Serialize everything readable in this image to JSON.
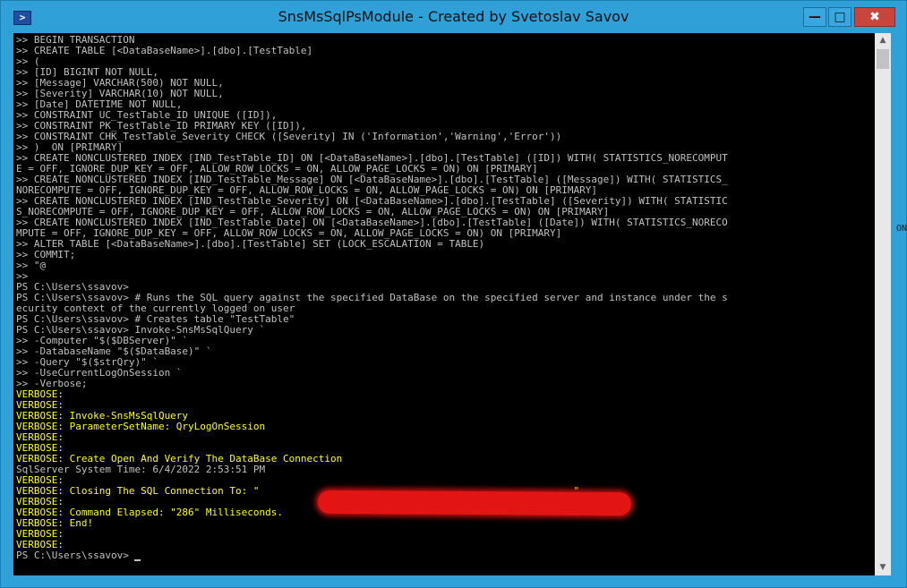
{
  "window": {
    "title": "SnsMsSqlPsModule - Created by Svetoslav Savov",
    "app_icon_glyph": ">",
    "buttons": {
      "minimize": "—",
      "maximize": "□",
      "close": "✖"
    }
  },
  "console": {
    "colors": {
      "background": "#000000",
      "text": "#c0c0c0",
      "verbose": "#ffff00"
    },
    "lines": [
      {
        "text": ">> BEGIN TRANSACTION",
        "verbose": false
      },
      {
        "text": ">> CREATE TABLE [<DataBaseName>].[dbo].[TestTable]",
        "verbose": false
      },
      {
        "text": ">> (",
        "verbose": false
      },
      {
        "text": ">> [ID] BIGINT NOT NULL,",
        "verbose": false
      },
      {
        "text": ">> [Message] VARCHAR(500) NOT NULL,",
        "verbose": false
      },
      {
        "text": ">> [Severity] VARCHAR(10) NOT NULL,",
        "verbose": false
      },
      {
        "text": ">> [Date] DATETIME NOT NULL,",
        "verbose": false
      },
      {
        "text": ">> CONSTRAINT UC_TestTable_ID UNIQUE ([ID]),",
        "verbose": false
      },
      {
        "text": ">> CONSTRAINT PK_TestTable_ID PRIMARY KEY ([ID]),",
        "verbose": false
      },
      {
        "text": ">> CONSTRAINT CHK_TestTable_Severity CHECK ([Severity] IN ('Information','Warning','Error'))",
        "verbose": false
      },
      {
        "text": ">> )  ON [PRIMARY]",
        "verbose": false
      },
      {
        "text": ">> CREATE NONCLUSTERED INDEX [IND_TestTable_ID] ON [<DataBaseName>].[dbo].[TestTable] ([ID]) WITH( STATISTICS_NORECOMPUT",
        "verbose": false
      },
      {
        "text": "E = OFF, IGNORE_DUP_KEY = OFF, ALLOW_ROW_LOCKS = ON, ALLOW_PAGE_LOCKS = ON) ON [PRIMARY]",
        "verbose": false
      },
      {
        "text": ">> CREATE NONCLUSTERED INDEX [IND_TestTable_Message] ON [<DataBaseName>].[dbo].[TestTable] ([Message]) WITH( STATISTICS_",
        "verbose": false
      },
      {
        "text": "NORECOMPUTE = OFF, IGNORE_DUP_KEY = OFF, ALLOW_ROW_LOCKS = ON, ALLOW_PAGE_LOCKS = ON) ON [PRIMARY]",
        "verbose": false
      },
      {
        "text": ">> CREATE NONCLUSTERED INDEX [IND_TestTable_Severity] ON [<DataBaseName>].[dbo].[TestTable] ([Severity]) WITH( STATISTIC",
        "verbose": false
      },
      {
        "text": "S_NORECOMPUTE = OFF, IGNORE_DUP_KEY = OFF, ALLOW_ROW_LOCKS = ON, ALLOW_PAGE_LOCKS = ON) ON [PRIMARY]",
        "verbose": false
      },
      {
        "text": ">> CREATE NONCLUSTERED INDEX [IND_TestTable_Date] ON [<DataBaseName>].[dbo].[TestTable] ([Date]) WITH( STATISTICS_NORECO",
        "verbose": false
      },
      {
        "text": "MPUTE = OFF, IGNORE_DUP_KEY = OFF, ALLOW_ROW_LOCKS = ON, ALLOW_PAGE_LOCKS = ON) ON [PRIMARY]",
        "verbose": false
      },
      {
        "text": ">> ALTER TABLE [<DataBaseName>].[dbo].[TestTable] SET (LOCK_ESCALATION = TABLE)",
        "verbose": false
      },
      {
        "text": ">> COMMIT;",
        "verbose": false
      },
      {
        "text": ">> \"@",
        "verbose": false
      },
      {
        "text": ">>",
        "verbose": false
      },
      {
        "text": "PS C:\\Users\\ssavov>",
        "verbose": false
      },
      {
        "text": "PS C:\\Users\\ssavov> # Runs the SQL query against the specified DataBase on the specified server and instance under the s",
        "verbose": false
      },
      {
        "text": "ecurity context of the currently logged on user",
        "verbose": false
      },
      {
        "text": "PS C:\\Users\\ssavov> # Creates table \"TestTable\"",
        "verbose": false
      },
      {
        "text": "PS C:\\Users\\ssavov> Invoke-SnsMsSqlQuery `",
        "verbose": false
      },
      {
        "text": ">> -Computer \"$($DBServer)\" `",
        "verbose": false
      },
      {
        "text": ">> -DatabaseName \"$($DataBase)\" `",
        "verbose": false
      },
      {
        "text": ">> -Query \"$($strQry)\" `",
        "verbose": false
      },
      {
        "text": ">> -UseCurrentLogOnSession `",
        "verbose": false
      },
      {
        "text": ">> -Verbose;",
        "verbose": false
      },
      {
        "text": "VERBOSE:",
        "verbose": true
      },
      {
        "text": "VERBOSE:",
        "verbose": true
      },
      {
        "text": "VERBOSE: Invoke-SnsMsSqlQuery",
        "verbose": true
      },
      {
        "text": "VERBOSE: ParameterSetName: QryLogOnSession",
        "verbose": true
      },
      {
        "text": "VERBOSE:",
        "verbose": true
      },
      {
        "text": "VERBOSE:",
        "verbose": true
      },
      {
        "text": "VERBOSE: Create Open And Verify The DataBase Connection",
        "verbose": true
      },
      {
        "text": "SqlServer System Time: 6/4/2022 2:53:51 PM",
        "verbose": false
      },
      {
        "text": "VERBOSE:",
        "verbose": true
      },
      {
        "text": "VERBOSE: Closing The SQL Connection To: \"                                                     \"",
        "verbose": true
      },
      {
        "text": "VERBOSE:",
        "verbose": true
      },
      {
        "text": "VERBOSE: Command Elapsed: \"286\" Milliseconds.",
        "verbose": true
      },
      {
        "text": "VERBOSE: End!",
        "verbose": true
      },
      {
        "text": "VERBOSE:",
        "verbose": true
      },
      {
        "text": "VERBOSE:",
        "verbose": true
      },
      {
        "text": "PS C:\\Users\\ssavov> ",
        "verbose": false,
        "cursor": true
      }
    ]
  },
  "side_fragment": "ON"
}
